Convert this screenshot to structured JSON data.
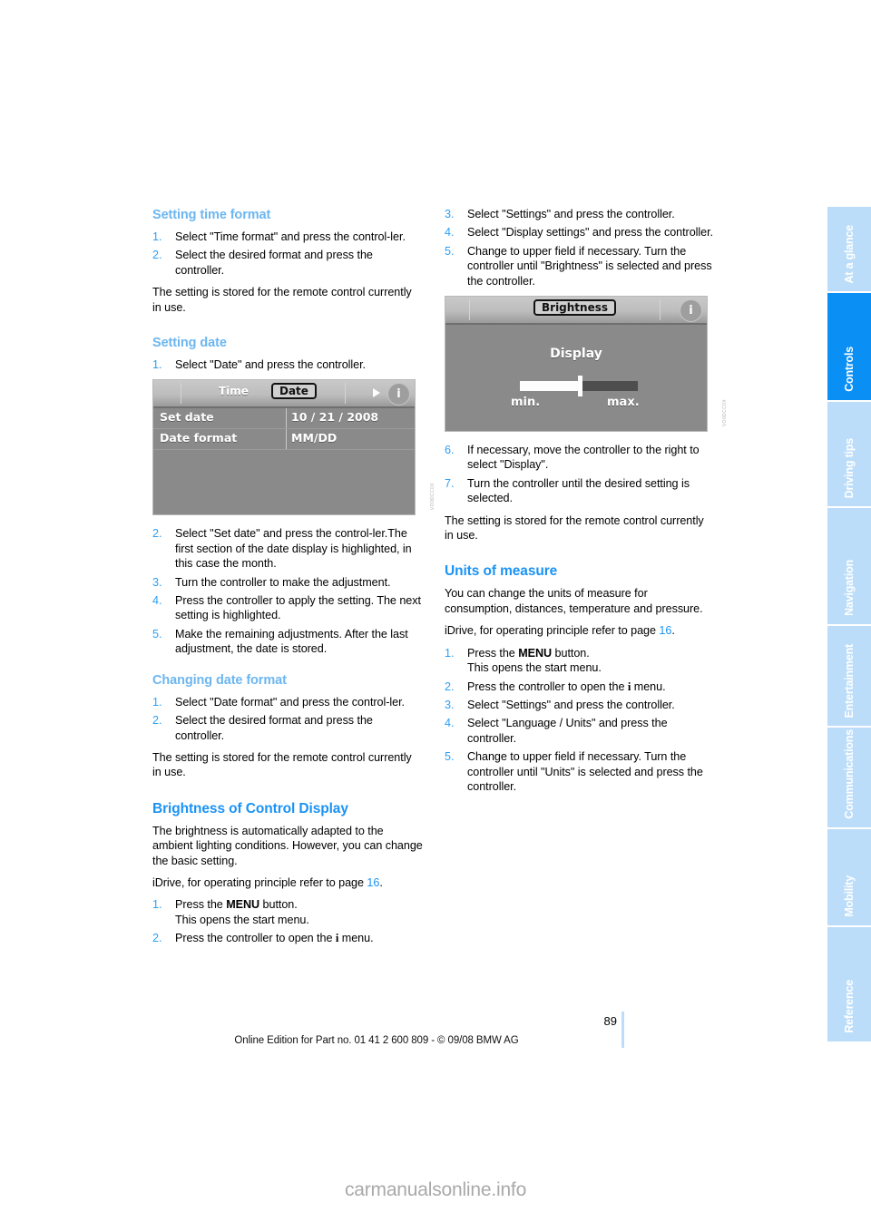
{
  "document": {
    "page_number": "89",
    "footer_note": "Online Edition for Part no. 01 41 2 600 809 - © 09/08 BMW AG",
    "watermark": "carmanualsonline.info"
  },
  "sidebar": {
    "tabs": [
      {
        "label": "At a glance",
        "active": false
      },
      {
        "label": "Controls",
        "active": true
      },
      {
        "label": "Driving tips",
        "active": false
      },
      {
        "label": "Navigation",
        "active": false
      },
      {
        "label": "Entertainment",
        "active": false
      },
      {
        "label": "Communications",
        "active": false
      },
      {
        "label": "Mobility",
        "active": false
      },
      {
        "label": "Reference",
        "active": false
      }
    ]
  },
  "left_column": {
    "section_time_format": {
      "heading": "Setting time format",
      "steps": [
        {
          "num": "1.",
          "text": "Select \"Time format\" and press the control-ler."
        },
        {
          "num": "2.",
          "text": "Select the desired format and press the controller."
        }
      ],
      "note": "The setting is stored for the remote control currently in use."
    },
    "section_setting_date": {
      "heading": "Setting date",
      "steps_before": [
        {
          "num": "1.",
          "text": "Select \"Date\" and press the controller."
        }
      ],
      "figure": {
        "tab_inactive": "Time",
        "tab_active": "Date",
        "rows": [
          {
            "label": "Set date",
            "value": "10 / 21 / 2008"
          },
          {
            "label": "Date format",
            "value": "MM/DD"
          }
        ],
        "info_icon": "i",
        "code": "VO0DCC0X"
      },
      "steps_after": [
        {
          "num": "2.",
          "text": "Select \"Set date\" and press the control-ler.The first section of the date display is highlighted, in this case the month."
        },
        {
          "num": "3.",
          "text": "Turn the controller to make the adjustment."
        },
        {
          "num": "4.",
          "text": "Press the controller to apply the setting. The next setting is highlighted."
        },
        {
          "num": "5.",
          "text": "Make the remaining adjustments. After the last adjustment, the date is stored."
        }
      ]
    },
    "section_changing_date_format": {
      "heading": "Changing date format",
      "steps": [
        {
          "num": "1.",
          "text": "Select \"Date format\" and press the control-ler."
        },
        {
          "num": "2.",
          "text": "Select the desired format and press the controller."
        }
      ],
      "note": "The setting is stored for the remote control currently in use."
    },
    "section_brightness": {
      "heading": "Brightness of Control Display",
      "intro": "The brightness is automatically adapted to the ambient lighting conditions. However, you can change the basic setting.",
      "idrive_ref_prefix": "iDrive, for operating principle refer to page ",
      "idrive_ref_page": "16",
      "idrive_ref_suffix": ".",
      "steps": [
        {
          "num": "1.",
          "prefix": "Press the ",
          "bold": "MENU",
          "suffix": " button.",
          "second_line": "This opens the start menu."
        },
        {
          "num": "2.",
          "prefix": "Press the controller to open the ",
          "bold": "i",
          "suffix": " menu.",
          "second_line": ""
        }
      ]
    }
  },
  "right_column": {
    "steps_top": [
      {
        "num": "3.",
        "text": "Select \"Settings\" and press the controller."
      },
      {
        "num": "4.",
        "text": "Select \"Display settings\" and press the controller."
      },
      {
        "num": "5.",
        "text": "Change to upper field if necessary. Turn the controller until \"Brightness\" is selected and press the controller."
      }
    ],
    "figure": {
      "tab_active": "Brightness",
      "body_title": "Display",
      "slider_min_label": "min.",
      "slider_max_label": "max.",
      "slider_value_percent": 50,
      "info_icon": "i",
      "code": "VO0DCC0X"
    },
    "steps_after": [
      {
        "num": "6.",
        "text": "If necessary, move the controller to the right to select \"Display\"."
      },
      {
        "num": "7.",
        "text": "Turn the controller until the desired setting is selected."
      }
    ],
    "note": "The setting is stored for the remote control currently in use.",
    "section_units": {
      "heading": "Units of measure",
      "intro": "You can change the units of measure for consumption, distances, temperature and pressure.",
      "idrive_ref_prefix": "iDrive, for operating principle refer to page ",
      "idrive_ref_page": "16",
      "idrive_ref_suffix": ".",
      "steps": [
        {
          "num": "1.",
          "prefix": "Press the ",
          "bold": "MENU",
          "suffix": " button.",
          "second_line": "This opens the start menu."
        },
        {
          "num": "2.",
          "prefix": "Press the controller to open the ",
          "bold": "i",
          "suffix": " menu.",
          "second_line": ""
        },
        {
          "num": "3.",
          "prefix": "Select \"Settings\" and press the controller.",
          "bold": "",
          "suffix": "",
          "second_line": ""
        },
        {
          "num": "4.",
          "prefix": "Select \"Language / Units\" and press the controller.",
          "bold": "",
          "suffix": "",
          "second_line": ""
        },
        {
          "num": "5.",
          "prefix": "Change to upper field if necessary. Turn the controller until \"Units\" is selected and press the controller.",
          "bold": "",
          "suffix": "",
          "second_line": ""
        }
      ]
    }
  }
}
